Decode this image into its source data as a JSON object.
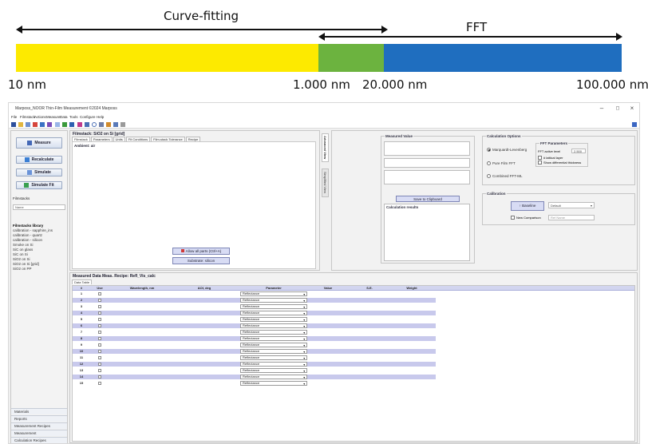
{
  "diagram": {
    "curve_label": "Curve-fitting",
    "fft_label": "FFT",
    "ticks": [
      "10 nm",
      "1.000 nm",
      "20.000 nm",
      "100.000 nm"
    ],
    "colors": {
      "yellow": "#fdea00",
      "green": "#6cb33f",
      "blue": "#1f6ebf"
    }
  },
  "app": {
    "title": "Marposs_NOOR Thin-Film Measurement ©2024 Marposs",
    "menu": [
      "File",
      "Filmstack",
      "Actions",
      "Measure",
      "Data",
      "Tools",
      "Configure",
      "Help"
    ],
    "left": {
      "measure": "Measure",
      "recalculate": "Recalculate",
      "simulate": "Simulate",
      "simulate_fit": "Simulate Fit",
      "filmstacks_header": "Filmstacks",
      "search_placeholder": "Name",
      "items": [
        "Filmstacks library",
        "calibration - sapphire_ins",
        "calibration - quartz",
        "calibration - silicon",
        "Smoke on Si",
        "SiC on glass",
        "SiC on Si",
        "SiO2 on Si",
        "SiO2 on Si [grid]",
        "SiO2 on PP"
      ],
      "bottom": [
        "Materials",
        "Reports",
        "Measurement Recipes",
        "Measurement",
        "Calculation Recipes"
      ]
    },
    "film": {
      "title": "Filmstack: SiO2 on Si [grid]",
      "tabs": [
        "Filmstack",
        "Parameters",
        "Units",
        "Fit Conditions",
        "Film-stack Tolerance",
        "Recipe"
      ],
      "ambient": "Ambient: air",
      "btn_allow": "Allow all parts (Ctrl+A)",
      "btn_substrate": "Substrate: silicon",
      "vtab_advanced": "Advanced View",
      "vtab_simplified": "Simplified View"
    },
    "measured": {
      "legend": "Measured Value",
      "save_clipboard": "Save to Clipboard",
      "calc_results": "Calculation results"
    },
    "calc_options": {
      "legend": "Calculation Options",
      "options": [
        "Marquardt-Levenberg",
        "Pure Film FFT",
        "Combined FFT-ML"
      ],
      "fft_legend": "FFT Parameters",
      "fft_label": "FFT active level",
      "fft_value": "2.500",
      "fft_checks": [
        "# lattical layer",
        "Show differential thickness"
      ]
    },
    "calibration": {
      "legend": "Calibration",
      "baseline": "Baseline",
      "default": "Default",
      "new_comparison": "New Comparison",
      "new_comparison_placeholder": "Ref Name"
    },
    "data": {
      "title": "Measured Data Meas. Recipe: Refl_Vis_calc",
      "tab": "Data Table",
      "headers": [
        "#",
        "Use",
        "Wavelength, nm",
        "AOI, deg",
        "Parameter",
        "Value",
        "S.E.",
        "Weight"
      ],
      "param_value": "Reflectance",
      "rows": [
        "1",
        "2",
        "3",
        "4",
        "5",
        "6",
        "7",
        "8",
        "9",
        "10",
        "11",
        "12",
        "13",
        "14",
        "15"
      ]
    }
  }
}
